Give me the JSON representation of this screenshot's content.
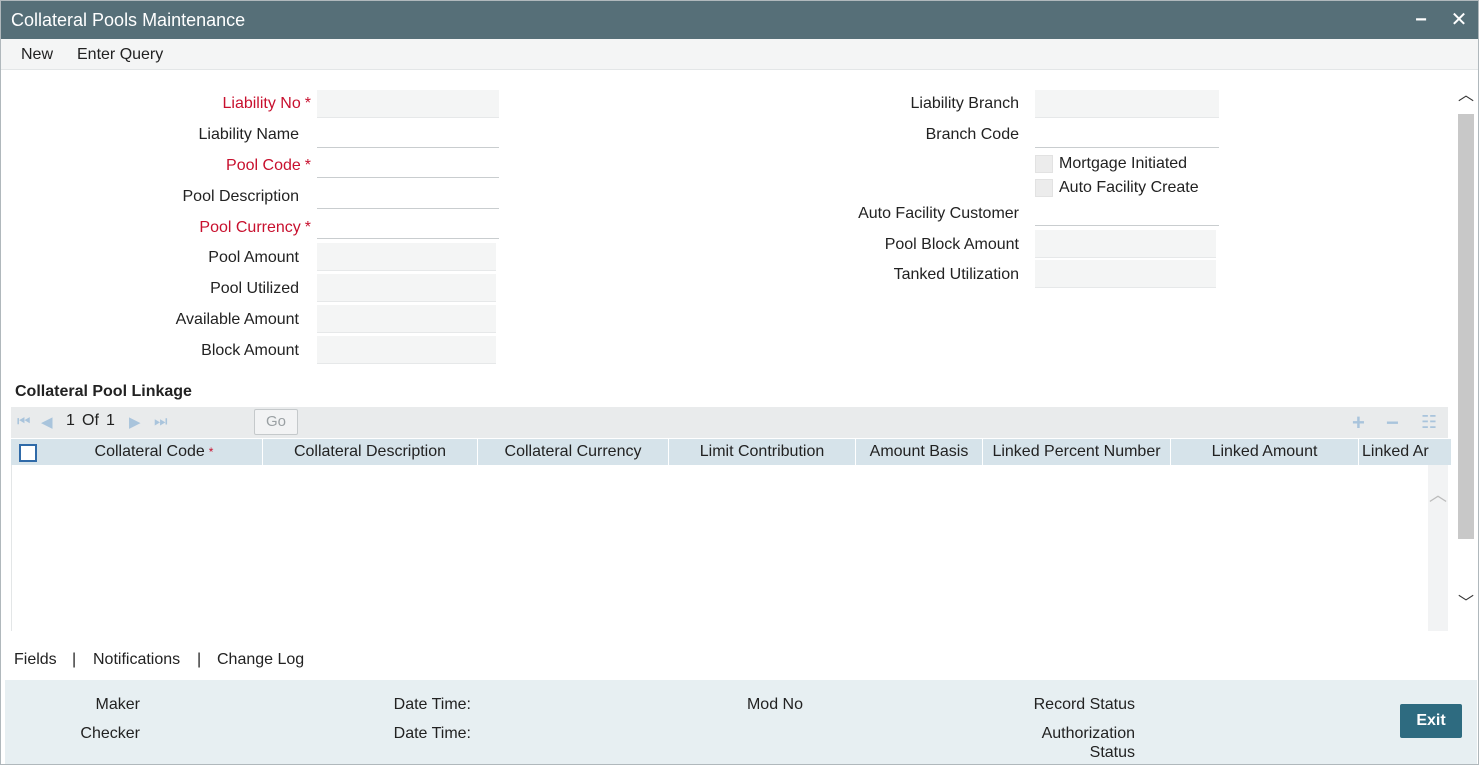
{
  "window": {
    "title": "Collateral Pools Maintenance",
    "minimize_glyph": "−",
    "close_glyph": "✕"
  },
  "menu": {
    "new": "New",
    "enter_query": "Enter Query"
  },
  "form": {
    "liability_no": {
      "label": "Liability No",
      "value": "",
      "required": true
    },
    "liability_name": {
      "label": "Liability Name",
      "value": ""
    },
    "pool_code": {
      "label": "Pool Code",
      "value": "",
      "required": true
    },
    "pool_description": {
      "label": "Pool Description",
      "value": ""
    },
    "pool_currency": {
      "label": "Pool Currency",
      "value": "",
      "required": true
    },
    "pool_amount": {
      "label": "Pool Amount",
      "value": ""
    },
    "pool_utilized": {
      "label": "Pool Utilized",
      "value": ""
    },
    "available_amount": {
      "label": "Available Amount",
      "value": ""
    },
    "block_amount": {
      "label": "Block Amount",
      "value": ""
    },
    "liability_branch": {
      "label": "Liability Branch",
      "value": ""
    },
    "branch_code": {
      "label": "Branch Code",
      "value": ""
    },
    "mortgage_initiated": {
      "label": "Mortgage Initiated",
      "checked": false
    },
    "auto_facility_create": {
      "label": "Auto Facility Create",
      "checked": false
    },
    "auto_facility_customer": {
      "label": "Auto Facility Customer",
      "value": ""
    },
    "pool_block_amount": {
      "label": "Pool Block Amount",
      "value": ""
    },
    "tanked_utilization": {
      "label": "Tanked Utilization",
      "value": ""
    },
    "required_marker": "*"
  },
  "linkage": {
    "section_title": "Collateral Pool Linkage",
    "pager": {
      "current": "1",
      "of_label": "Of",
      "total": "1",
      "go_label": "Go"
    },
    "columns": [
      "Collateral Code",
      "Collateral Description",
      "Collateral Currency",
      "Limit Contribution",
      "Amount Basis",
      "Linked Percent Number",
      "Linked Amount",
      "Linked Ar"
    ],
    "rows": []
  },
  "tabs": {
    "fields": "Fields",
    "notifications": "Notifications",
    "change_log": "Change Log",
    "separator": "|"
  },
  "footer": {
    "maker": "Maker",
    "checker": "Checker",
    "date_time_1": "Date Time:",
    "date_time_2": "Date Time:",
    "mod_no": "Mod No",
    "record_status": "Record Status",
    "authorization": "Authorization",
    "status": "Status",
    "exit": "Exit"
  },
  "colors": {
    "titlebar": "#566f78",
    "required": "#c8102e",
    "grid_header": "#d6e3ea",
    "footer": "#e7eff2",
    "exit_button": "#2e6b80"
  }
}
